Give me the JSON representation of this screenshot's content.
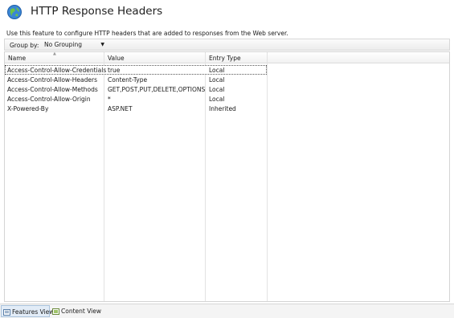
{
  "header": {
    "icon": "globe-icon",
    "title": "HTTP Response Headers",
    "description": "Use this feature to configure HTTP headers that are added to responses from the Web server."
  },
  "toolbar": {
    "group_by_label": "Group by:",
    "group_by_value": "No Grouping"
  },
  "table": {
    "columns": [
      "Name",
      "Value",
      "Entry Type"
    ],
    "rows": [
      {
        "name": "Access-Control-Allow-Credentials",
        "value": "true",
        "type": "Local",
        "selected": true
      },
      {
        "name": "Access-Control-Allow-Headers",
        "value": "Content-Type",
        "type": "Local"
      },
      {
        "name": "Access-Control-Allow-Methods",
        "value": "GET,POST,PUT,DELETE,OPTIONS",
        "type": "Local"
      },
      {
        "name": "Access-Control-Allow-Origin",
        "value": "*",
        "type": "Local"
      },
      {
        "name": "X-Powered-By",
        "value": "ASP.NET",
        "type": "Inherited"
      }
    ]
  },
  "bottom_tabs": [
    {
      "label": "Features View",
      "icon": "features-view-icon",
      "active": true
    },
    {
      "label": "Content View",
      "icon": "content-view-icon",
      "active": false
    }
  ]
}
